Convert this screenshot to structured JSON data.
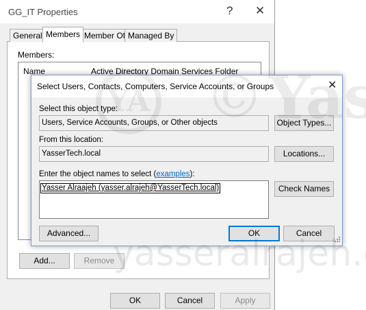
{
  "parent_window": {
    "title": "GG_IT Properties",
    "help_glyph": "?",
    "close_glyph": "✕",
    "tabs": [
      {
        "label": "General"
      },
      {
        "label": "Members"
      },
      {
        "label": "Member Of"
      },
      {
        "label": "Managed By"
      }
    ],
    "active_tab": "Members",
    "members_label": "Members:",
    "columns": {
      "name": "Name",
      "folder": "Active Directory Domain Services Folder"
    },
    "add_button": "Add...",
    "remove_button": "Remove",
    "ok_button": "OK",
    "cancel_button": "Cancel",
    "apply_button": "Apply"
  },
  "dialog": {
    "title": "Select Users, Contacts, Computers, Service Accounts, or Groups",
    "close_glyph": "✕",
    "object_type_label": "Select this object type:",
    "object_type_value": "Users, Service Accounts, Groups, or Other objects",
    "object_types_button": "Object Types...",
    "location_label": "From this location:",
    "location_value": "YasserTech.local",
    "locations_button": "Locations...",
    "names_label_prefix": "Enter the object names to select (",
    "names_label_link": "examples",
    "names_label_suffix": "):",
    "names_value": "Yasser Alraajeh (yasser.alrajeh@YasserTech.local)",
    "check_names_button": "Check Names",
    "advanced_button": "Advanced...",
    "ok_button": "OK",
    "cancel_button": "Cancel"
  },
  "watermark": {
    "logo": "YA",
    "symbol": "©",
    "text": "Yass",
    "url": "yasseralrajeh.co"
  },
  "colors": {
    "accent": "#0078d7",
    "link": "#0066cc",
    "face": "#f0f0f0",
    "button": "#e1e1e1"
  }
}
